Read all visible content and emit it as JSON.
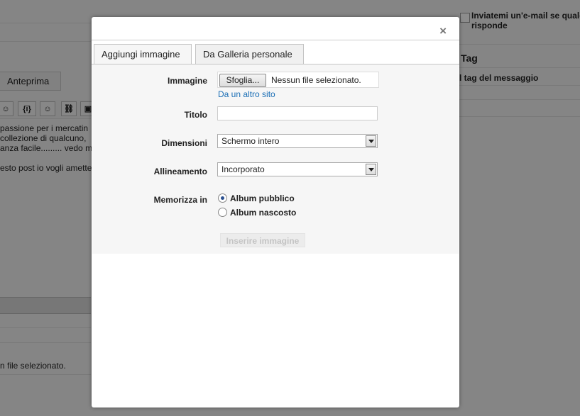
{
  "background": {
    "tab_preview": "Anteprima",
    "toolbar_icons": [
      "emoji-face-icon",
      "code-icon",
      "smiley-icon",
      "link-icon",
      "image-icon"
    ],
    "toolbar_code_label": "{i}",
    "text_lines": [
      "passione per i mercatin",
      "collezione di qualcuno,",
      "anza facile.........  vedo m",
      "esto post io vogli amette"
    ],
    "file_status_text": "n file selezionato.",
    "right": {
      "notify_label": "Inviatemi un'e-mail se qualc risponde",
      "tag_heading": "Tag",
      "tag_sub": "l tag del messaggio"
    }
  },
  "modal": {
    "close_symbol": "×",
    "tabs": [
      {
        "label": "Aggiungi immagine",
        "active": true
      },
      {
        "label": "Da Galleria personale",
        "active": false
      }
    ],
    "form": {
      "image_label": "Immagine",
      "browse_button": "Sfoglia...",
      "file_status": "Nessun file selezionato.",
      "other_site_link": "Da un altro sito",
      "title_label": "Titolo",
      "title_value": "",
      "dimensions_label": "Dimensioni",
      "dimensions_value": "Schermo intero",
      "alignment_label": "Allineamento",
      "alignment_value": "Incorporato",
      "store_label": "Memorizza in",
      "store_options": [
        {
          "label": "Album pubblico",
          "selected": true
        },
        {
          "label": "Album nascosto",
          "selected": false
        }
      ],
      "insert_button": "Inserire immagine"
    }
  }
}
